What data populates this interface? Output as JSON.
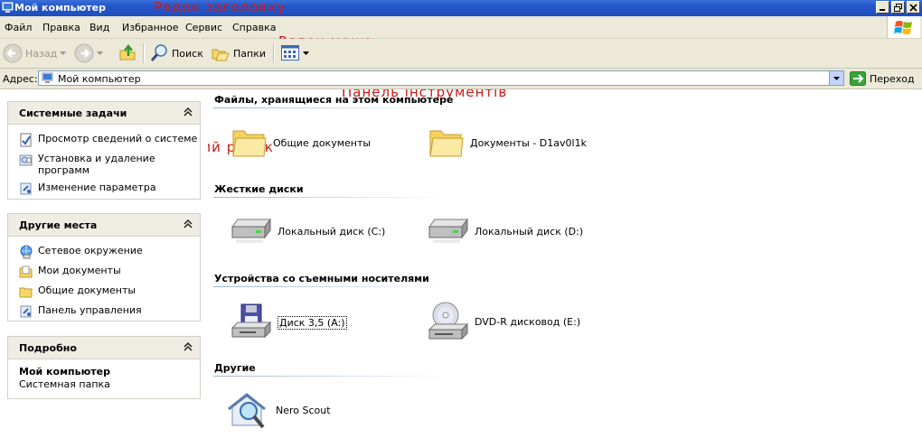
{
  "window": {
    "title": "Мой компьютер",
    "annotations": {
      "title_row": "Рядок заголовку",
      "menu_row": "Рядок меню",
      "toolbar_row": "Панель інструментів",
      "address_row": "Адресний рядок"
    }
  },
  "menu": [
    "Файл",
    "Правка",
    "Вид",
    "Избранное",
    "Сервис",
    "Справка"
  ],
  "toolbar": {
    "back_label": "Назад",
    "search_label": "Поиск",
    "folders_label": "Папки"
  },
  "address": {
    "label": "Адрес:",
    "value": "Мой компьютер",
    "go_label": "Переход"
  },
  "sidebar": {
    "system_tasks": {
      "title": "Системные задачи",
      "items": [
        "Просмотр сведений о системе",
        "Установка и удаление программ",
        "Изменение параметра"
      ]
    },
    "other_places": {
      "title": "Другие места",
      "items": [
        "Сетевое окружение",
        "Мои документы",
        "Общие документы",
        "Панель управления"
      ]
    },
    "details": {
      "title": "Подробно",
      "name": "Мой компьютер",
      "type": "Системная папка"
    }
  },
  "content": {
    "groups": [
      {
        "title": "Файлы, хранящиеся на этом компьютере",
        "items": [
          "Общие документы",
          "Документы - D1av0l1k"
        ]
      },
      {
        "title": "Жесткие диски",
        "items": [
          "Локальный диск (C:)",
          "Локальный диск (D:)"
        ]
      },
      {
        "title": "Устройства со съемными носителями",
        "items": [
          "Диск 3,5 (A:)",
          "DVD-R дисковод (E:)"
        ]
      },
      {
        "title": "Другие",
        "items": [
          "Nero Scout"
        ]
      }
    ]
  }
}
